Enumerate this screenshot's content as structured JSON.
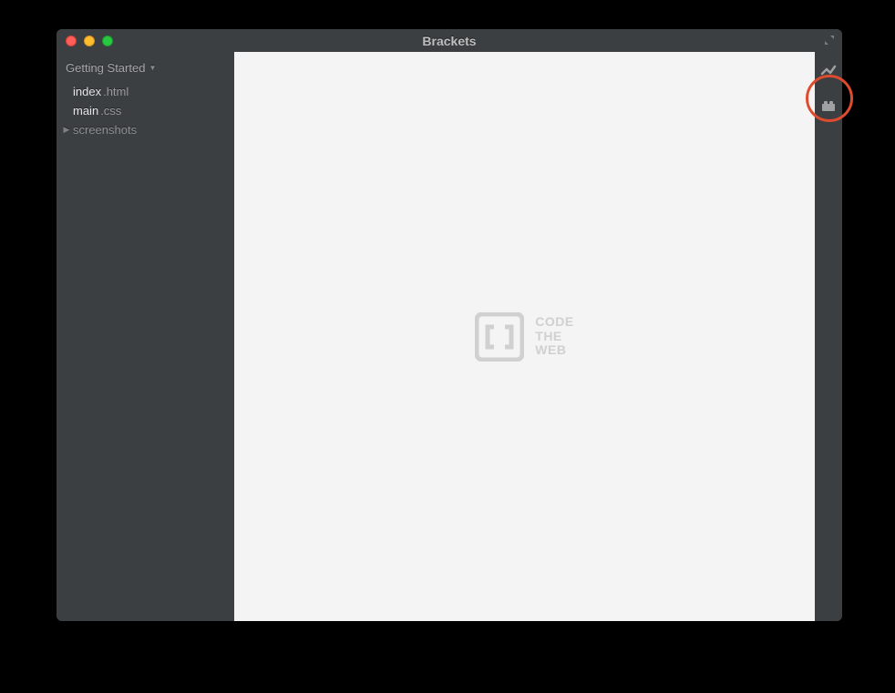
{
  "window": {
    "title": "Brackets"
  },
  "sidebar": {
    "project_name": "Getting Started",
    "items": [
      {
        "type": "file",
        "name": "index",
        "ext": ".html"
      },
      {
        "type": "file",
        "name": "main",
        "ext": ".css"
      },
      {
        "type": "folder",
        "name": "screenshots"
      }
    ]
  },
  "editor": {
    "placeholder_line1": "CODE",
    "placeholder_line2": "THE",
    "placeholder_line3": "WEB"
  },
  "rightbar": {
    "tools": [
      {
        "id": "live-preview",
        "icon": "bolt"
      },
      {
        "id": "extension-manager",
        "icon": "lego"
      }
    ]
  }
}
